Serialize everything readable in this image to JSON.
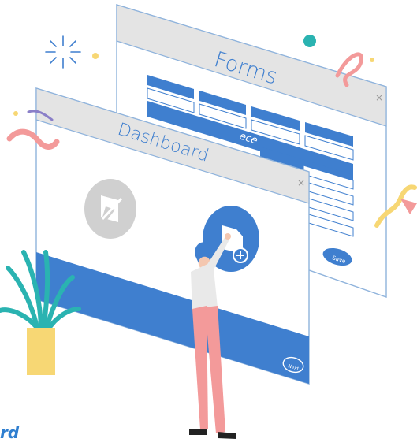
{
  "forms_window": {
    "title": "Forms",
    "handwriting": "ece",
    "save_label": "Save",
    "close_symbol": "×"
  },
  "dashboard_window": {
    "title": "Dashboard",
    "close_symbol": "×",
    "next_label": "Next"
  },
  "caption": {
    "text": "rd"
  },
  "colors": {
    "primary_blue": "#3f7fcf",
    "panel_gray": "#e4e4e4",
    "outline": "#8fb3dc",
    "pink": "#f39a9a",
    "teal": "#2ab3b1",
    "yellow": "#f7d774",
    "gray_icon": "#d0d0d0"
  },
  "icons": [
    "form-edit-icon",
    "add-document-icon",
    "close-icon",
    "sparkle-icon",
    "plant-decoration"
  ]
}
